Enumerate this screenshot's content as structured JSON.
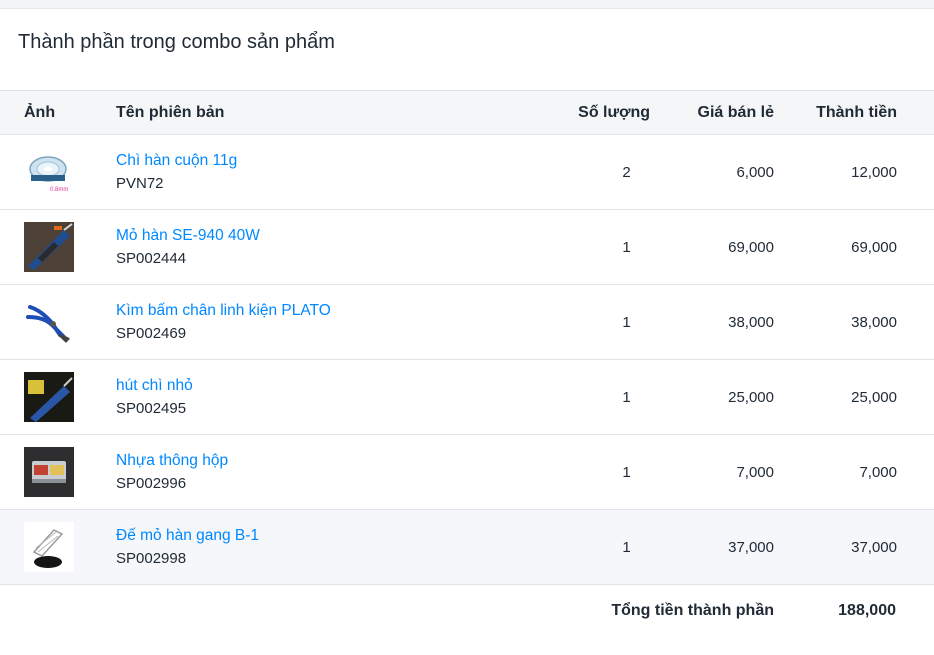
{
  "card": {
    "title": "Thành phần trong combo sản phẩm"
  },
  "columns": {
    "image": "Ảnh",
    "name": "Tên phiên bản",
    "qty": "Số lượng",
    "price": "Giá bán lẻ",
    "total": "Thành tiền"
  },
  "rows": [
    {
      "name": "Chì hàn cuộn 11g",
      "sku": "PVN72",
      "qty": "2",
      "price": "6,000",
      "total": "12,000",
      "image_icon": "solder-wire-roll",
      "image_label": "0.8mm"
    },
    {
      "name": "Mỏ hàn SE-940 40W",
      "sku": "SP002444",
      "qty": "1",
      "price": "69,000",
      "total": "69,000",
      "image_icon": "soldering-iron"
    },
    {
      "name": "Kìm bấm chân linh kiện PLATO",
      "sku": "SP002469",
      "qty": "1",
      "price": "38,000",
      "total": "38,000",
      "image_icon": "cutting-pliers"
    },
    {
      "name": "hút chì nhỏ",
      "sku": "SP002495",
      "qty": "1",
      "price": "25,000",
      "total": "25,000",
      "image_icon": "desoldering-pump"
    },
    {
      "name": "Nhựa thông hộp",
      "sku": "SP002996",
      "qty": "1",
      "price": "7,000",
      "total": "7,000",
      "image_icon": "rosin-box"
    },
    {
      "name": "Đế mỏ hàn gang B-1",
      "sku": "SP002998",
      "qty": "1",
      "price": "37,000",
      "total": "37,000",
      "image_icon": "soldering-stand"
    }
  ],
  "footer": {
    "label": "Tổng tiền thành phần",
    "total": "188,000"
  },
  "colors": {
    "link": "#0088ff",
    "header_bg": "#f4f6f8",
    "highlight_row": "#f5f7fa"
  }
}
